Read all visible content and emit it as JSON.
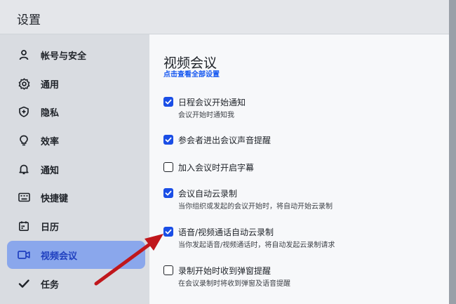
{
  "window": {
    "title": "设置"
  },
  "sidebar": {
    "items": [
      {
        "label": "帐号与安全",
        "icon": "user-icon",
        "active": false
      },
      {
        "label": "通用",
        "icon": "gear-icon",
        "active": false
      },
      {
        "label": "隐私",
        "icon": "shield-icon",
        "active": false
      },
      {
        "label": "效率",
        "icon": "lightbulb-icon",
        "active": false
      },
      {
        "label": "通知",
        "icon": "bell-icon",
        "active": false
      },
      {
        "label": "快捷键",
        "icon": "keyboard-icon",
        "active": false
      },
      {
        "label": "日历",
        "icon": "calendar-icon",
        "active": false
      },
      {
        "label": "视频会议",
        "icon": "video-camera-icon",
        "active": true
      },
      {
        "label": "任务",
        "icon": "check-icon",
        "active": false
      }
    ]
  },
  "main": {
    "title": "视频会议",
    "view_all_link": "点击查看全部设置",
    "options": [
      {
        "title": "日程会议开始通知",
        "desc": "会议开始时通知我",
        "checked": true
      },
      {
        "title": "参会者进出会议声音提醒",
        "desc": "",
        "checked": true
      },
      {
        "title": "加入会议时开启字幕",
        "desc": "",
        "checked": false
      },
      {
        "title": "会议自动云录制",
        "desc": "当你组织或发起的会议开始时，将自动开始云录制",
        "checked": true
      },
      {
        "title": "语音/视频通话自动云录制",
        "desc": "当你发起语音/视频通话时，将自动发起云录制请求",
        "checked": true
      },
      {
        "title": "录制开始时收到弹窗提醒",
        "desc": "在会议录制时将收到弹窗及语音提醒",
        "checked": false
      }
    ]
  },
  "annotation": {
    "arrow_color": "#c0171c"
  }
}
